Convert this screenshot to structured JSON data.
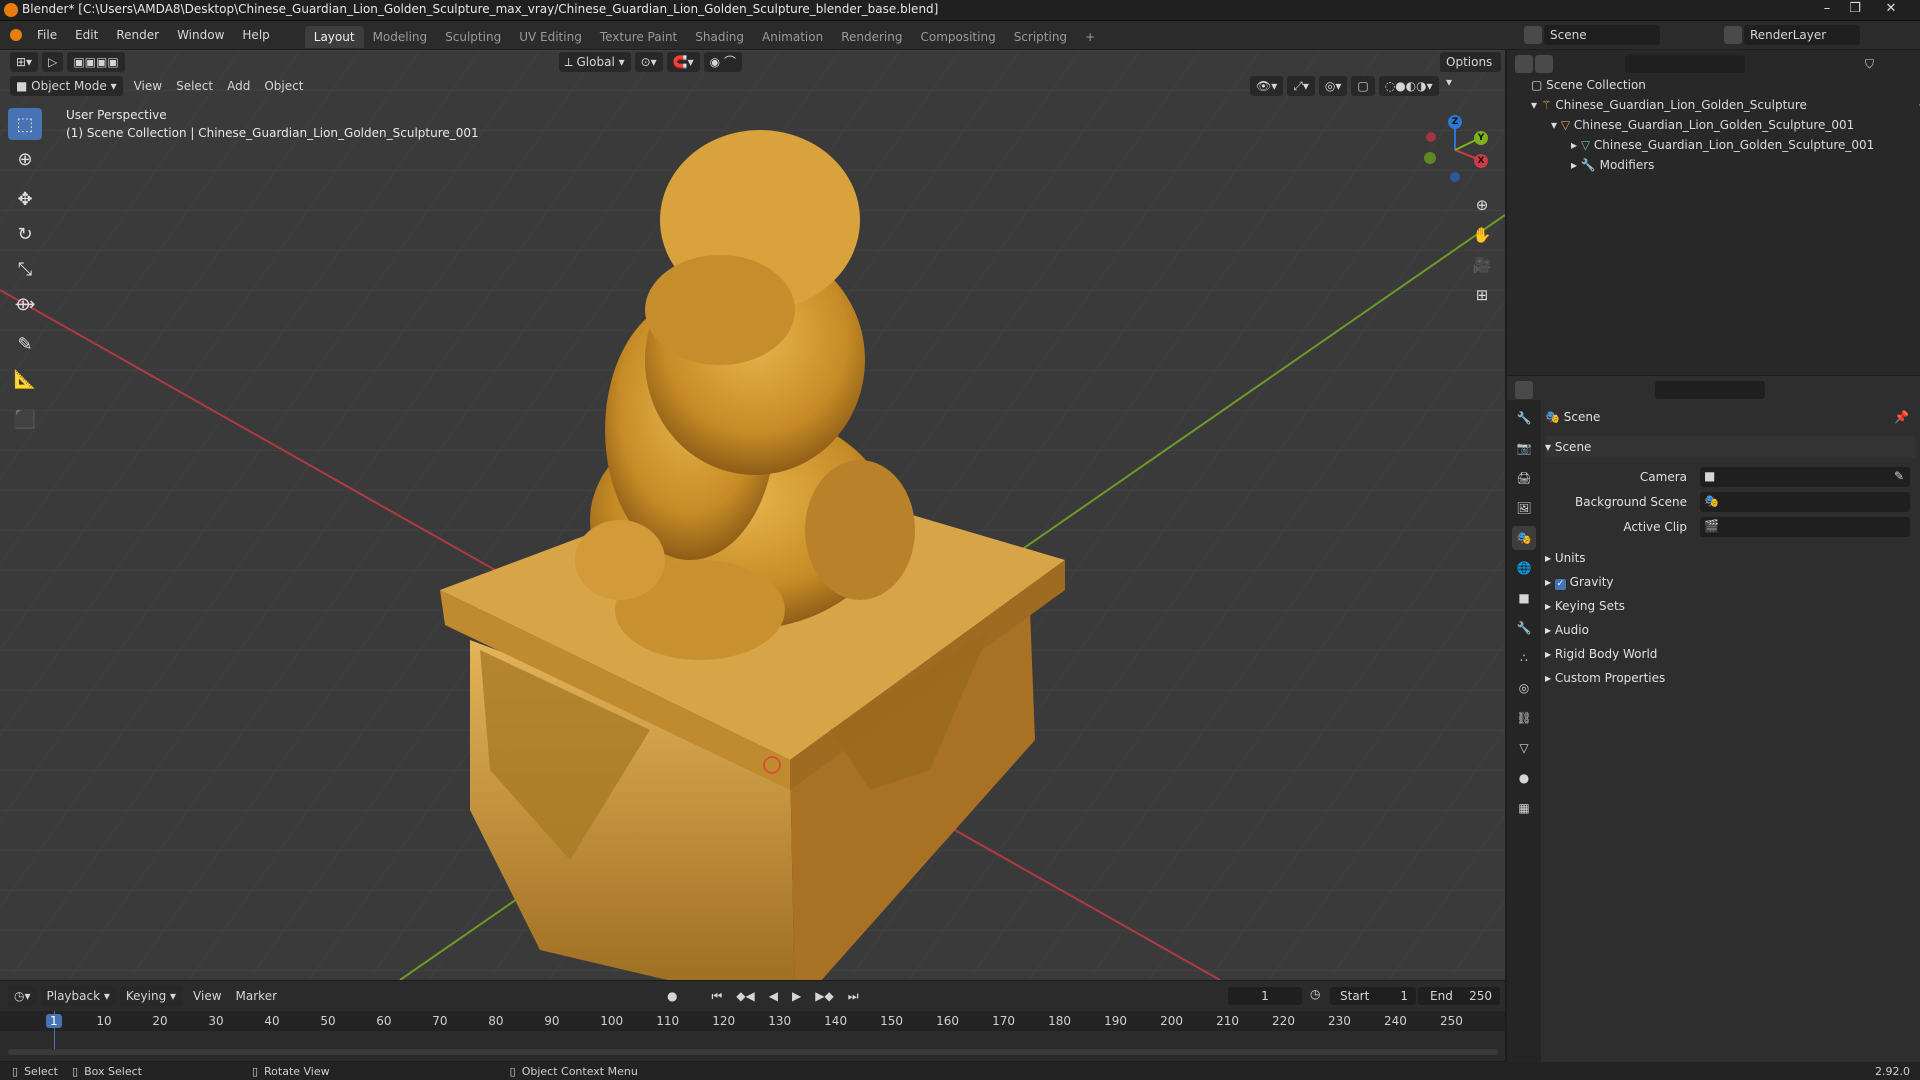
{
  "title_bar": {
    "title": "Blender* [C:\\Users\\AMDA8\\Desktop\\Chinese_Guardian_Lion_Golden_Sculpture_max_vray/Chinese_Guardian_Lion_Golden_Sculpture_blender_base.blend]"
  },
  "menu": {
    "items": [
      "File",
      "Edit",
      "Render",
      "Window",
      "Help"
    ]
  },
  "workspaces": {
    "tabs": [
      "Layout",
      "Modeling",
      "Sculpting",
      "UV Editing",
      "Texture Paint",
      "Shading",
      "Animation",
      "Rendering",
      "Compositing",
      "Scripting"
    ],
    "active": "Layout",
    "add": "+"
  },
  "scene_selector": {
    "value": "Scene"
  },
  "render_layer": {
    "value": "RenderLayer"
  },
  "viewport": {
    "transform_orientation": "Global",
    "options_label": "Options",
    "mode": "Object Mode",
    "menus": [
      "View",
      "Select",
      "Add",
      "Object"
    ],
    "perspective": "User Perspective",
    "collection_info": "(1) Scene Collection | Chinese_Guardian_Lion_Golden_Sculpture_001",
    "gizmo": {
      "x": "X",
      "y": "Y",
      "z": "Z"
    }
  },
  "outliner": {
    "root": "Scene Collection",
    "items": [
      {
        "label": "Chinese_Guardian_Lion_Golden_Sculpture",
        "indent": 1
      },
      {
        "label": "Chinese_Guardian_Lion_Golden_Sculpture_001",
        "indent": 2
      },
      {
        "label": "Chinese_Guardian_Lion_Golden_Sculpture_001",
        "indent": 3
      },
      {
        "label": "Modifiers",
        "indent": 3
      }
    ]
  },
  "properties": {
    "context": "Scene",
    "panel": "Scene",
    "fields": {
      "camera": "Camera",
      "background_scene": "Background Scene",
      "active_clip": "Active Clip"
    },
    "sections": [
      "Units",
      "Gravity",
      "Keying Sets",
      "Audio",
      "Rigid Body World",
      "Custom Properties"
    ],
    "gravity_checked": true
  },
  "timeline": {
    "menus": [
      "Playback",
      "Keying",
      "View",
      "Marker"
    ],
    "current_frame": "1",
    "start_label": "Start",
    "start": "1",
    "end_label": "End",
    "end": "250",
    "ticks": [
      "1",
      "10",
      "20",
      "30",
      "40",
      "50",
      "60",
      "70",
      "80",
      "90",
      "100",
      "110",
      "120",
      "130",
      "140",
      "150",
      "160",
      "170",
      "180",
      "190",
      "200",
      "210",
      "220",
      "230",
      "240",
      "250"
    ]
  },
  "status_bar": {
    "select": "Select",
    "box_select": "Box Select",
    "rotate_view": "Rotate View",
    "context_menu": "Object Context Menu",
    "version": "2.92.0"
  },
  "colors": {
    "accent": "#4772b3",
    "x_axis": "#d03b48",
    "y_axis": "#7db21c",
    "z_axis": "#2b77d4",
    "gold": "#d19a35"
  }
}
